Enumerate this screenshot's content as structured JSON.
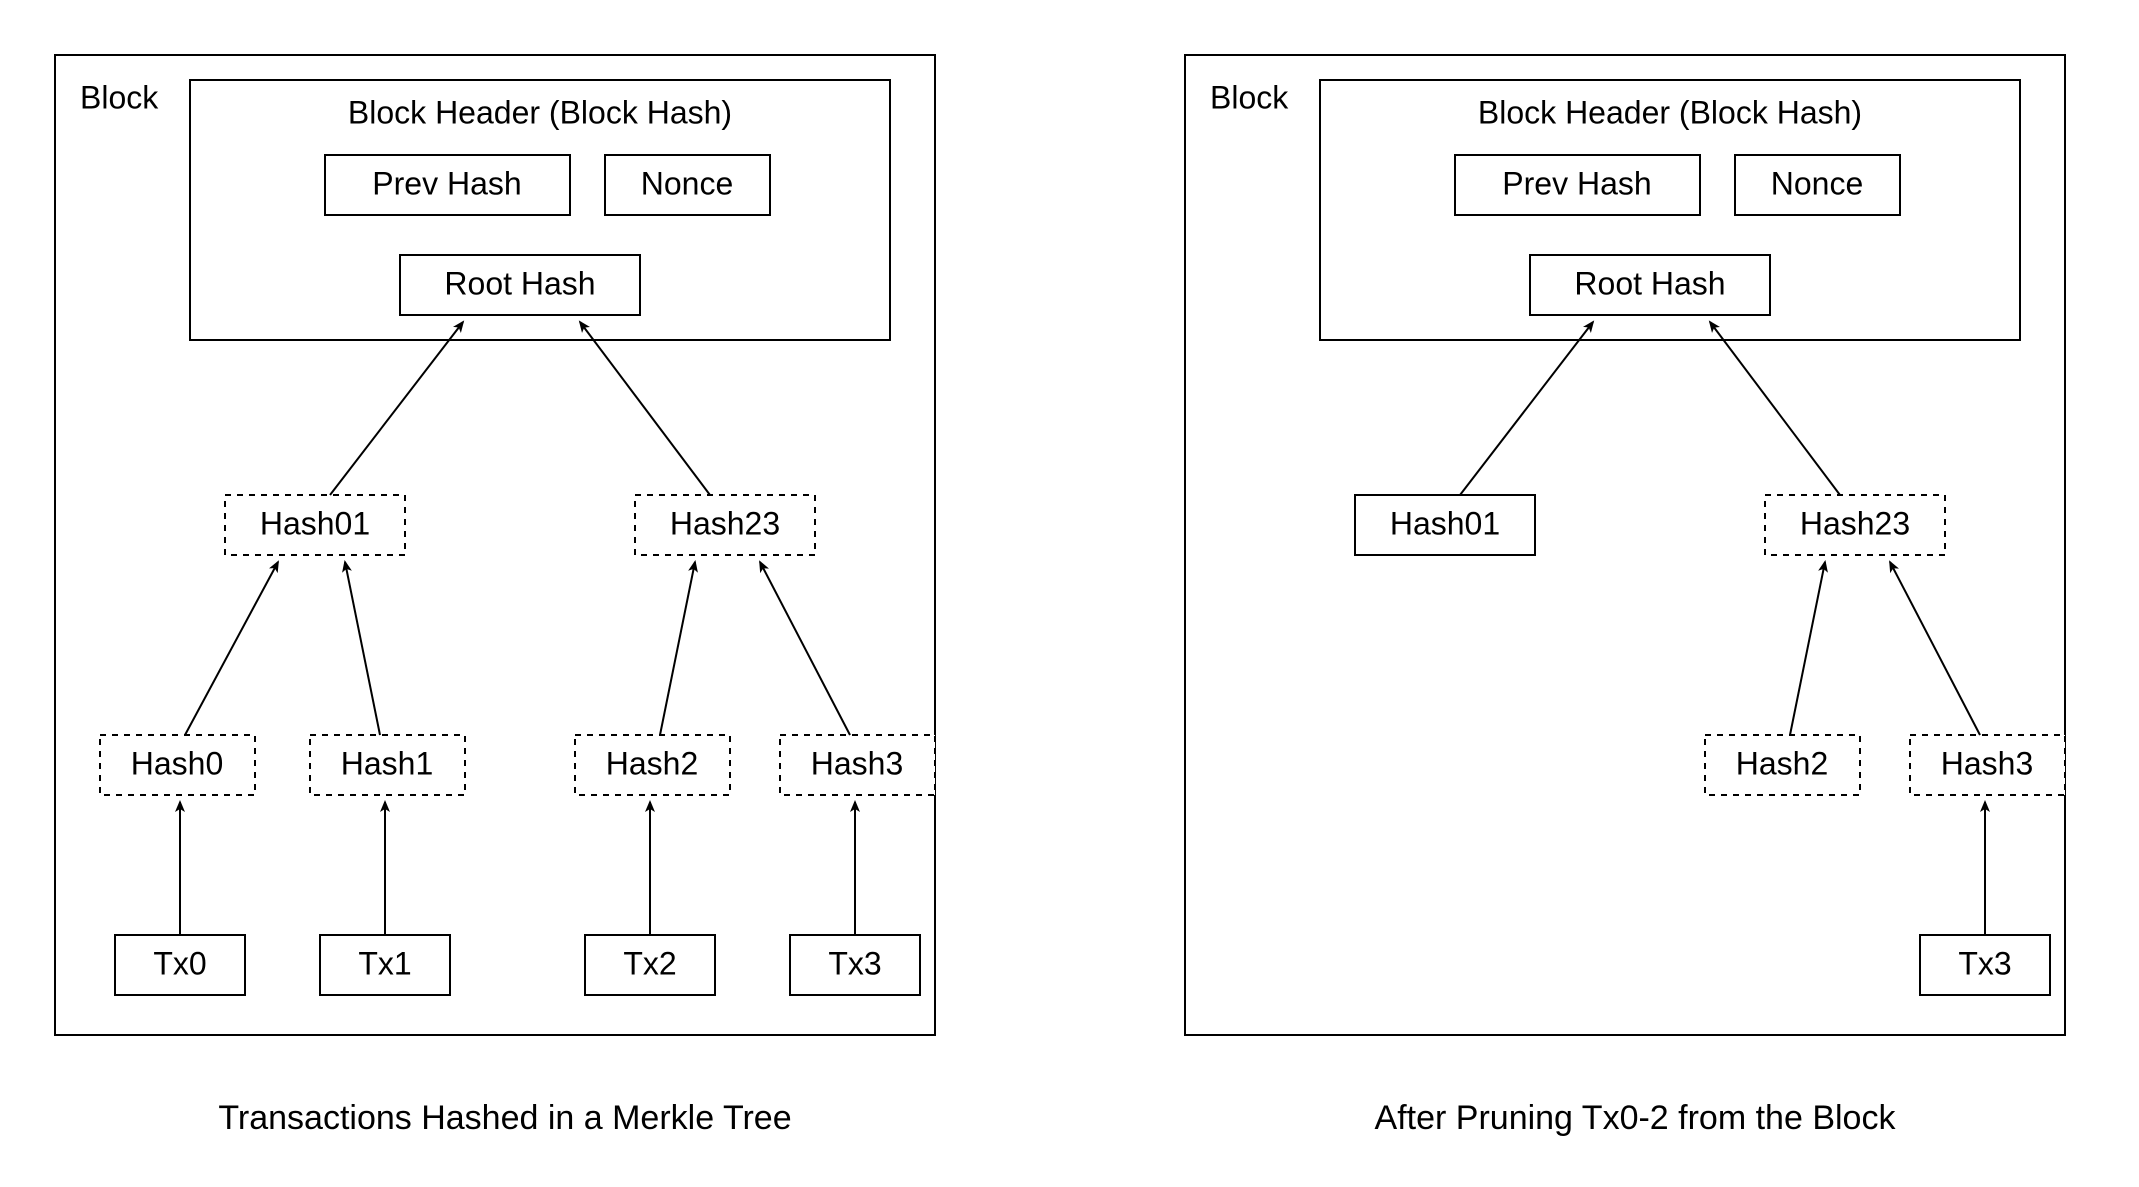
{
  "left": {
    "block_label": "Block",
    "header_title": "Block Header (Block Hash)",
    "prev_hash": "Prev Hash",
    "nonce": "Nonce",
    "root_hash": "Root Hash",
    "hash01": "Hash01",
    "hash23": "Hash23",
    "hash0": "Hash0",
    "hash1": "Hash1",
    "hash2": "Hash2",
    "hash3": "Hash3",
    "tx0": "Tx0",
    "tx1": "Tx1",
    "tx2": "Tx2",
    "tx3": "Tx3",
    "caption": "Transactions Hashed in a Merkle Tree"
  },
  "right": {
    "block_label": "Block",
    "header_title": "Block Header (Block Hash)",
    "prev_hash": "Prev Hash",
    "nonce": "Nonce",
    "root_hash": "Root Hash",
    "hash01": "Hash01",
    "hash23": "Hash23",
    "hash2": "Hash2",
    "hash3": "Hash3",
    "tx3": "Tx3",
    "caption": "After Pruning Tx0-2 from the Block"
  }
}
